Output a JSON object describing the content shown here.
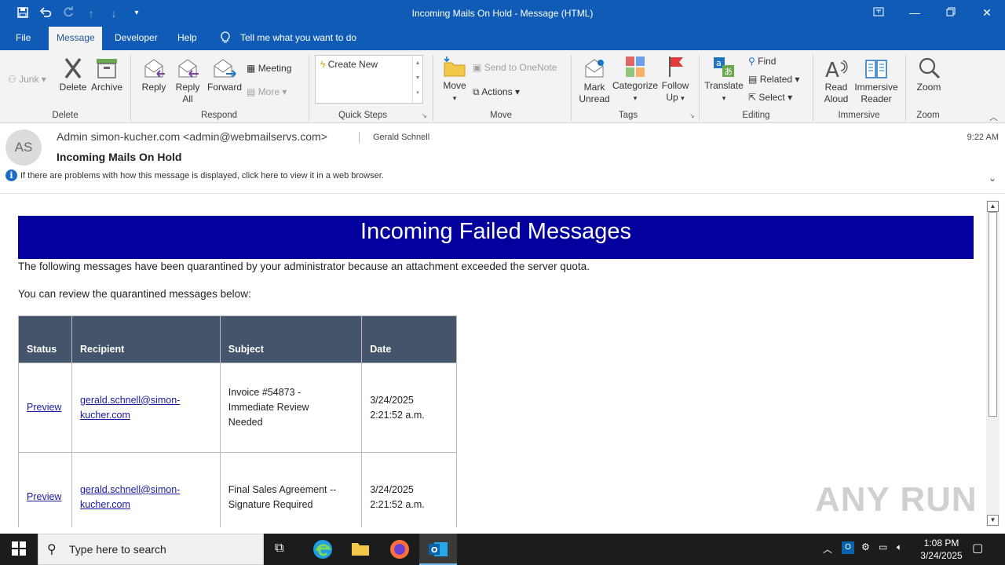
{
  "window": {
    "title": "Incoming Mails On Hold  -  Message (HTML)"
  },
  "menu": {
    "tabs": [
      "File",
      "Message",
      "Developer",
      "Help"
    ],
    "tell_me": "Tell me what you want to do"
  },
  "ribbon": {
    "junk": "Junk",
    "delete": "Delete",
    "archive": "Archive",
    "reply": "Reply",
    "reply_all_1": "Reply",
    "reply_all_2": "All",
    "forward": "Forward",
    "meeting": "Meeting",
    "more": "More",
    "create_new": "Create New",
    "move": "Move",
    "send_to_onenote": "Send to OneNote",
    "actions": "Actions",
    "mark_unread_1": "Mark",
    "mark_unread_2": "Unread",
    "categorize": "Categorize",
    "follow_up_1": "Follow",
    "follow_up_2": "Up",
    "translate": "Translate",
    "find": "Find",
    "related": "Related",
    "select": "Select",
    "read_aloud_1": "Read",
    "read_aloud_2": "Aloud",
    "immersive_reader_1": "Immersive",
    "immersive_reader_2": "Reader",
    "zoom": "Zoom",
    "groups": {
      "delete": "Delete",
      "respond": "Respond",
      "quick_steps": "Quick Steps",
      "move": "Move",
      "tags": "Tags",
      "editing": "Editing",
      "immersive": "Immersive",
      "zoom": "Zoom"
    }
  },
  "message": {
    "avatar_initials": "AS",
    "from": "Admin simon-kucher.com <admin@webmailservs.com>",
    "to": "Gerald Schnell",
    "time": "9:22 AM",
    "subject": "Incoming Mails On Hold",
    "info_bar": "If there are problems with how this message is displayed, click here to view it in a web browser."
  },
  "email_body": {
    "banner": "Incoming Failed Messages",
    "paragraph1": "The following messages have been quarantined by your administrator because an attachment  exceeded the server quota.",
    "paragraph2": "You can review the  quarantined messages below:",
    "table_headers": [
      "Status",
      "Recipient",
      "Subject",
      "Date"
    ],
    "rows": [
      {
        "status": "Preview",
        "recipient_1": "gerald.schnell@simon-",
        "recipient_2": "kucher.com",
        "subject_1": "Invoice #54873 -",
        "subject_2": "Immediate Review",
        "subject_3": "Needed",
        "date_1": "3/24/2025",
        "date_2": "2:21:52  a.m."
      },
      {
        "status": "Preview",
        "recipient_1": "gerald.schnell@simon-",
        "recipient_2": "kucher.com",
        "subject_1": "Final Sales Agreement --",
        "subject_2": "Signature Required",
        "subject_3": "",
        "date_1": "3/24/2025",
        "date_2": "2:21:52  a.m."
      }
    ]
  },
  "watermark": "ANY RUN",
  "taskbar": {
    "search_placeholder": "Type here to search",
    "clock_time": "1:08 PM",
    "clock_date": "3/24/2025"
  },
  "colors": {
    "titlebar": "#0f5bb5",
    "banner": "#03009d",
    "table_header": "#44546a"
  }
}
